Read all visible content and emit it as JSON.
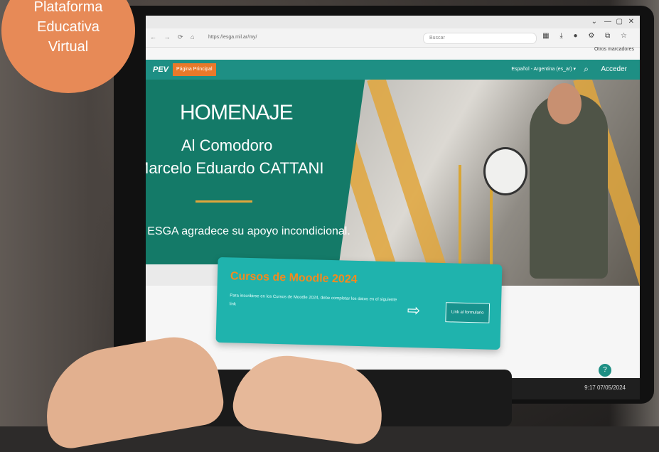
{
  "badge": {
    "line1": "Plataforma",
    "line2": "Educativa",
    "line3": "Virtual"
  },
  "browser": {
    "url": "https://esga.mil.ar/my/",
    "search_placeholder": "Buscar",
    "bookmarks_label": "Otros marcadores"
  },
  "site": {
    "logo": "PEV",
    "home_tab": "Página Principal",
    "language": "Español - Argentina (es_ar) ▾",
    "login": "Acceder"
  },
  "banner": {
    "title": "HOMENAJE",
    "subtitle1": "Al Comodoro",
    "subtitle2": "Marcelo Eduardo CATTANI",
    "thanks": "La ESGA agradece su apoyo incondicional."
  },
  "card": {
    "title": "Cursos de Moodle 2024",
    "text": "Para inscribirse en los Cursos de Moodle 2024, debe completar los datos en el siguiente link",
    "button": "Link al formulario"
  },
  "taskbar": {
    "time": "9:17",
    "date": "07/05/2024"
  },
  "colors": {
    "header": "#1e8f84",
    "accent": "#e9792a",
    "card": "#1fb3ad",
    "banner": "#147a68",
    "stripe": "#e0a63c"
  }
}
